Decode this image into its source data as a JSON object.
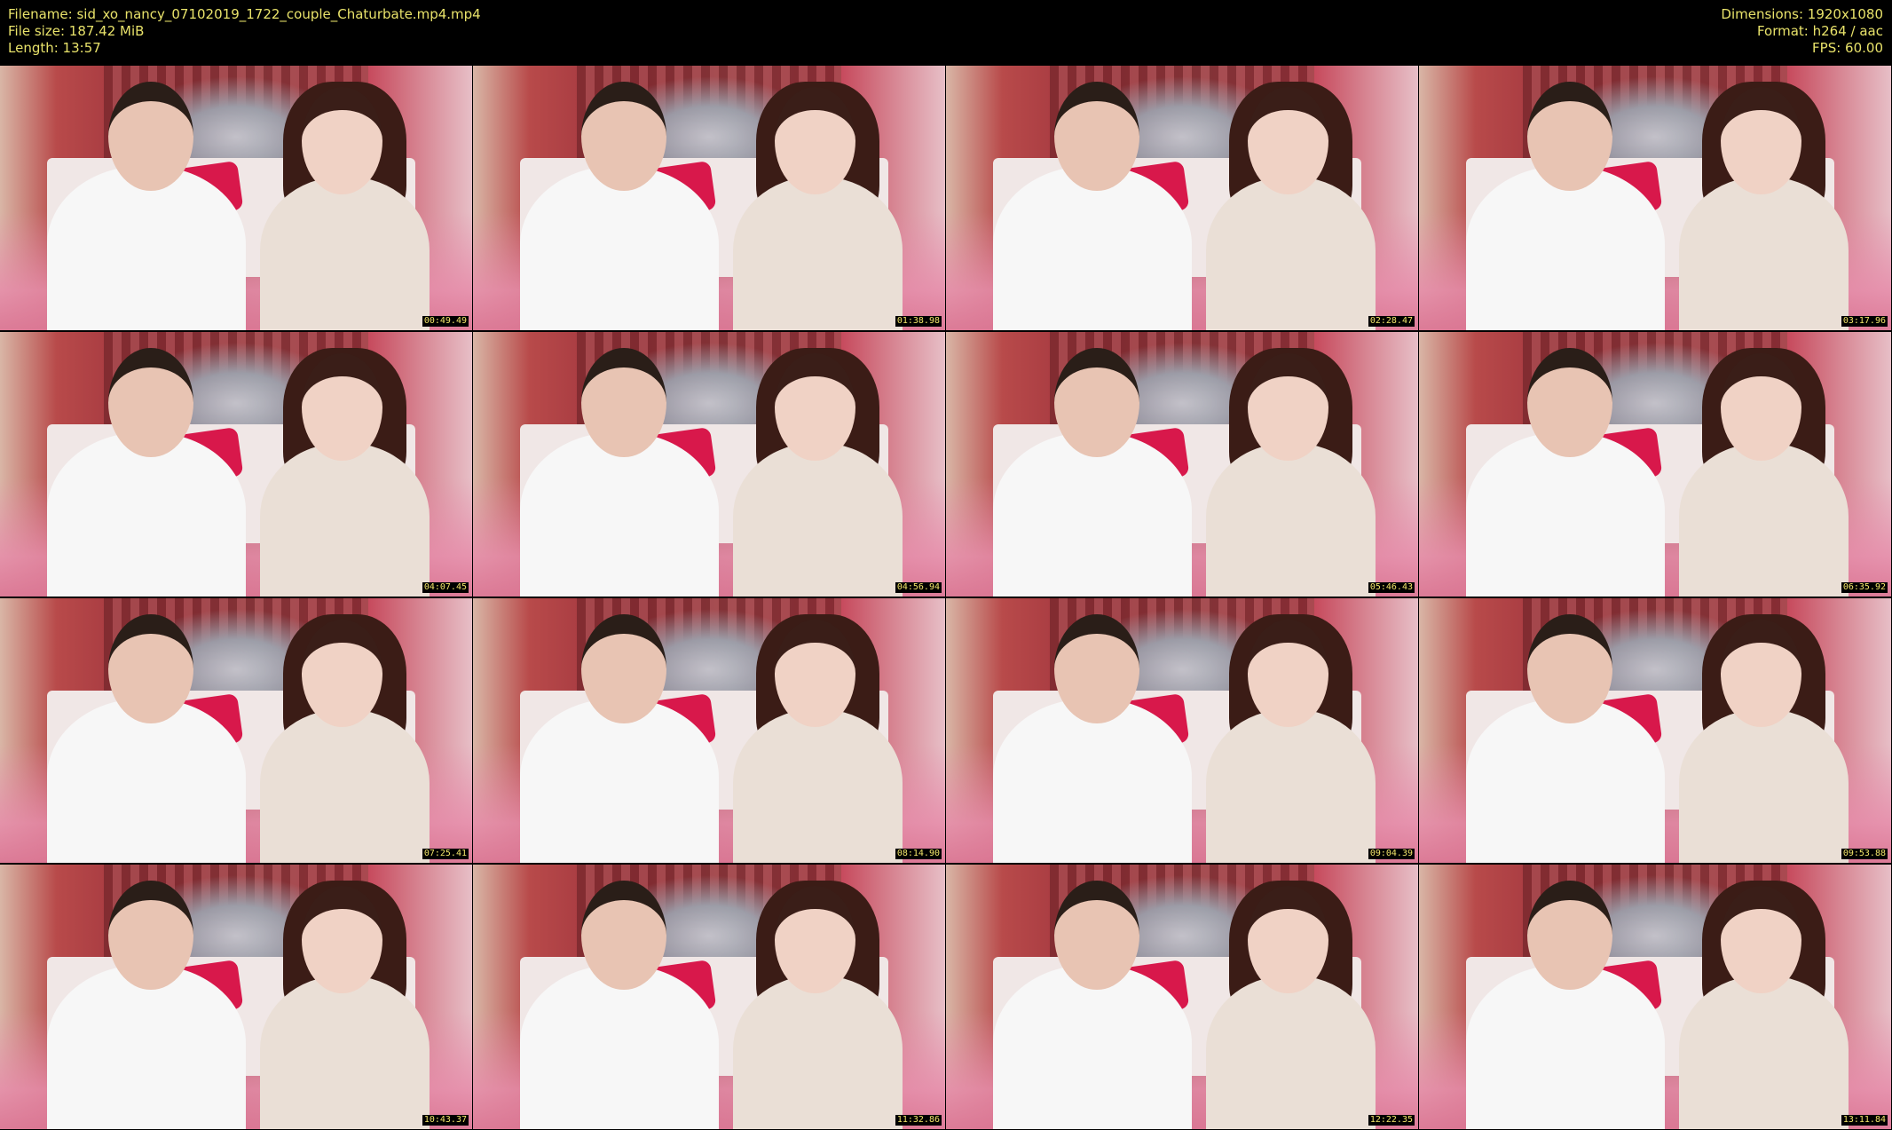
{
  "header": {
    "filename_label": "Filename: sid_xo_nancy_07102019_1722_couple_Chaturbate.mp4.mp4",
    "filesize_label": "File size: 187.42 MiB",
    "length_label": "Length: 13:57",
    "dimensions_label": "Dimensions: 1920x1080",
    "format_label": "Format: h264 / aac",
    "fps_label": "FPS: 60.00"
  },
  "colors": {
    "text_accent": "#e8e26a",
    "background": "#000000"
  },
  "thumbnails": [
    {
      "timecode": "00:49.49"
    },
    {
      "timecode": "01:38.98"
    },
    {
      "timecode": "02:28.47"
    },
    {
      "timecode": "03:17.96"
    },
    {
      "timecode": "04:07.45"
    },
    {
      "timecode": "04:56.94"
    },
    {
      "timecode": "05:46.43"
    },
    {
      "timecode": "06:35.92"
    },
    {
      "timecode": "07:25.41"
    },
    {
      "timecode": "08:14.90"
    },
    {
      "timecode": "09:04.39"
    },
    {
      "timecode": "09:53.88"
    },
    {
      "timecode": "10:43.37"
    },
    {
      "timecode": "11:32.86"
    },
    {
      "timecode": "12:22.35"
    },
    {
      "timecode": "13:11.84"
    }
  ]
}
